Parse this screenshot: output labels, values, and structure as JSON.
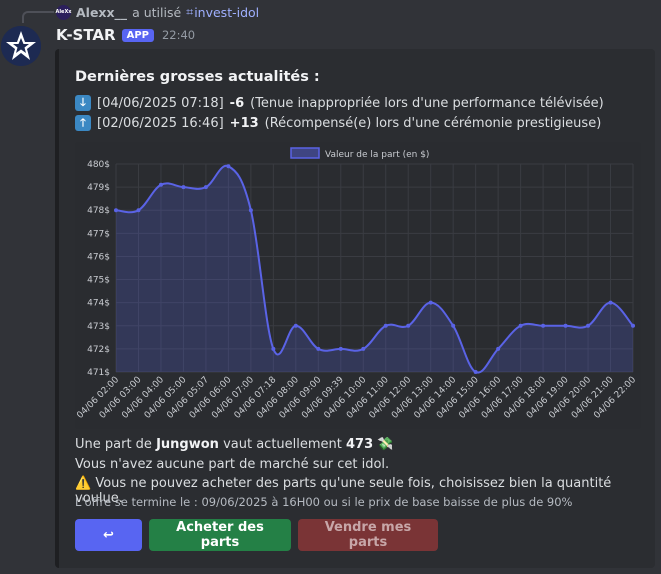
{
  "reply": {
    "user": "Alexx__",
    "action": "a utilisé",
    "command": "invest-idol",
    "avatar_text": "AleXx"
  },
  "message": {
    "bot_name": "K-STAR",
    "badge": "APP",
    "time": "22:40"
  },
  "embed": {
    "title": "Dernières grosses actualités :",
    "news": [
      {
        "icon": "arrow-down-icon",
        "date": "[04/06/2025 07:18]",
        "change": "-6",
        "reason": "(Tenue inappropriée lors d'une performance télévisée)"
      },
      {
        "icon": "arrow-up-icon",
        "date": "[02/06/2025 16:46]",
        "change": "+13",
        "reason": "(Récompensé(e) lors d'une cérémonie prestigieuse)"
      }
    ],
    "info_prefix": "Une part de",
    "idol_name": "Jungwon",
    "info_middle": "vaut actuellement",
    "current_value": "473",
    "no_share": "Vous n'avez aucune part de marché sur cet idol.",
    "warning_icon": "⚠️",
    "warning": "Vous ne pouvez acheter des parts qu'une seule fois, choisissez bien la quantité voulue.",
    "money_icon": "💸",
    "footer": "L'offre se termine le : 09/06/2025 à 16H00 ou si le prix de base baisse de plus de 90%"
  },
  "buttons": {
    "refresh_icon": "↩",
    "buy_label": "Acheter des parts",
    "sell_label": "Vendre mes parts"
  },
  "colors": {
    "line": "#5a63e6",
    "fill": "rgba(88,99,230,0.22)",
    "grid": "#3a3c42",
    "tick": "#c9ccd1"
  },
  "chart_data": {
    "type": "area",
    "legend": "Valeur de la part (en $)",
    "legend_position": "top-center",
    "grid": true,
    "ylim": [
      471,
      480
    ],
    "y_ticks": [
      "471$",
      "472$",
      "473$",
      "474$",
      "475$",
      "476$",
      "477$",
      "478$",
      "479$",
      "480$"
    ],
    "x": [
      "04/06 02:00",
      "04/06 03:00",
      "04/06 04:00",
      "04/06 05:00",
      "04/06 05:07",
      "04/06 06:00",
      "04/06 07:00",
      "04/06 07:18",
      "04/06 08:00",
      "04/06 09:00",
      "04/06 09:39",
      "04/06 10:00",
      "04/06 11:00",
      "04/06 12:00",
      "04/06 13:00",
      "04/06 14:00",
      "04/06 15:00",
      "04/06 16:00",
      "04/06 17:00",
      "04/06 18:00",
      "04/06 19:00",
      "04/06 20:00",
      "04/06 21:00",
      "04/06 22:00"
    ],
    "series": [
      {
        "name": "Valeur de la part (en $)",
        "values": [
          478,
          478,
          479.1,
          479,
          479,
          479.9,
          478,
          472,
          473,
          472,
          472,
          472,
          473,
          473,
          474,
          473,
          471,
          472,
          473,
          473,
          473,
          473,
          474,
          473
        ]
      }
    ]
  }
}
